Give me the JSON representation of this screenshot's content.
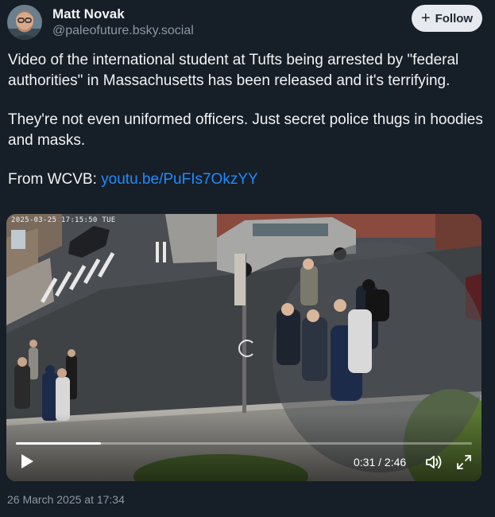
{
  "author": {
    "display_name": "Matt Novak",
    "handle": "@paleofuture.bsky.social",
    "avatar_icon": "user-avatar"
  },
  "follow_button": {
    "label": "Follow",
    "icon": "plus-icon"
  },
  "post": {
    "paragraph_1": "Video of the international student at Tufts being arrested by \"federal authorities\" in Massachusetts has been released and it's terrifying.",
    "paragraph_2": "They're not even uniformed officers. Just secret police thugs in hoodies and masks.",
    "link_prefix": "From WCVB: ",
    "link_text": "youtu.be/PuFIs7OkzYY"
  },
  "video": {
    "camera_timestamp": "2025-03-25 17:15:50 TUE",
    "current_time": "0:31",
    "duration": "2:46",
    "time_display": "0:31 / 2:46",
    "progress": 0.187,
    "play_icon": "play-icon",
    "volume_icon": "volume-icon",
    "fullscreen_icon": "fullscreen-icon"
  },
  "post_date": "26 March 2025 at 17:34",
  "colors": {
    "background": "#161e27",
    "link": "#208bfe",
    "muted": "#8b98a5",
    "follow_bg": "#e6e9ee"
  }
}
